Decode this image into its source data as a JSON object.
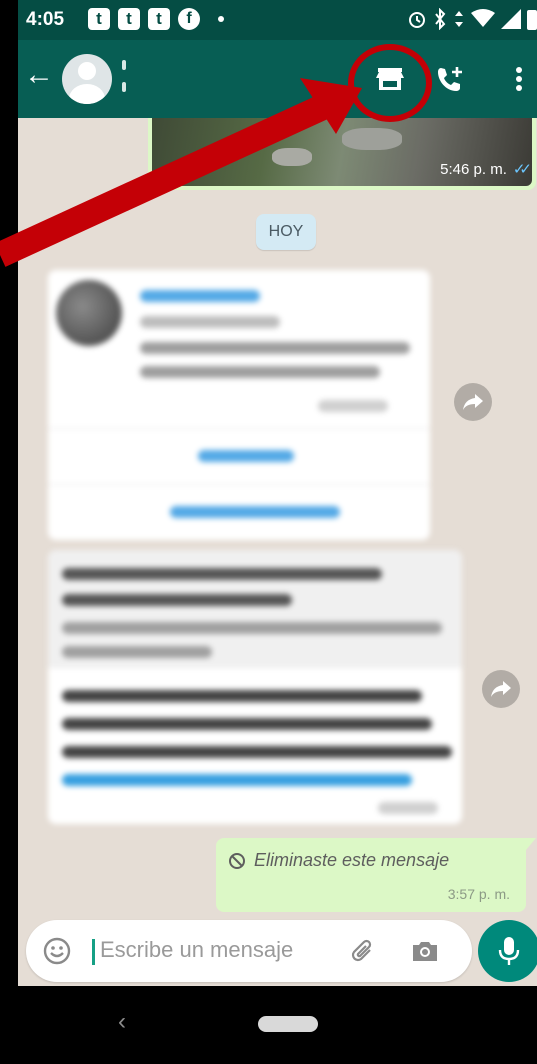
{
  "status_bar": {
    "time": "4:05",
    "notif_icons": [
      "tumblr-icon",
      "tumblr-icon",
      "tumblr-icon",
      "facebook-icon"
    ],
    "right_icons": [
      "alarm-icon",
      "bluetooth-icon",
      "data-arrows-icon",
      "wifi-icon",
      "signal-icon",
      "battery-icon"
    ]
  },
  "toolbar": {
    "actions": [
      "back-arrow-icon",
      "storefront-icon",
      "add-call-icon",
      "more-vert-icon"
    ],
    "highlight_color": "#c40006"
  },
  "chat": {
    "photo_message": {
      "time": "5:46 p. m."
    },
    "date_divider": "HOY",
    "deleted_message": {
      "text": "Eliminaste este mensaje",
      "time": "3:57 p. m."
    }
  },
  "input": {
    "placeholder": "Escribe un mensaje",
    "icons": [
      "emoji-icon",
      "attach-icon",
      "camera-icon",
      "mic-icon"
    ]
  },
  "colors": {
    "header": "#075e54",
    "status": "#054d44",
    "outgoing_bubble": "#dcf8c6",
    "chat_bg": "#e5ddd5",
    "accent": "#00897b"
  }
}
